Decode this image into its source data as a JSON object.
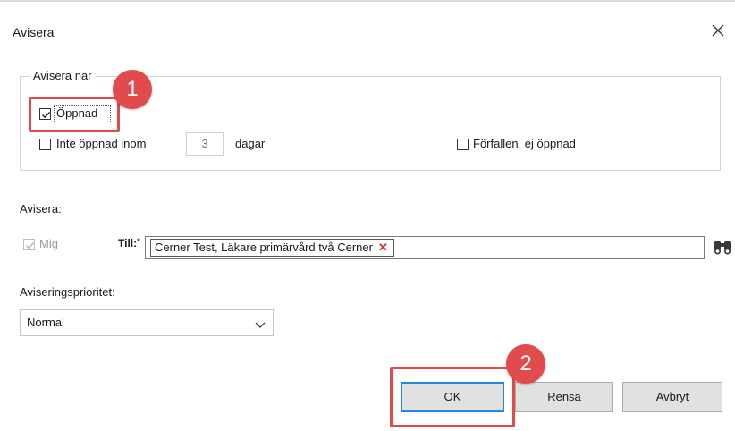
{
  "dialog": {
    "title": "Avisera",
    "close_icon": "close-icon"
  },
  "notify_when": {
    "legend": "Avisera när",
    "opened": {
      "label": "Öppnad",
      "checked": true
    },
    "not_opened": {
      "label": "Inte öppnad inom",
      "checked": false,
      "days_value": "3",
      "days_unit": "dagar"
    },
    "overdue": {
      "label": "Förfallen, ej öppnad",
      "checked": false
    }
  },
  "notify": {
    "heading": "Avisera:",
    "me": {
      "label": "Mig",
      "checked": true,
      "disabled": true
    },
    "to_label": "Till:",
    "to_marker": "*",
    "recipients": [
      {
        "name": "Cerner Test, Läkare primärvård två Cerner",
        "remove_icon": "remove-x-icon"
      }
    ],
    "search_icon": "binoculars-icon"
  },
  "priority": {
    "label": "Aviseringsprioritet:",
    "selected": "Normal"
  },
  "buttons": {
    "ok": "OK",
    "clear": "Rensa",
    "cancel": "Avbryt"
  },
  "annotations": {
    "step1": "1",
    "step2": "2",
    "highlight_color": "#e04a4a"
  },
  "colors": {
    "ok_focus_border": "#1e88e5",
    "remove_x": "#d62a2a"
  }
}
